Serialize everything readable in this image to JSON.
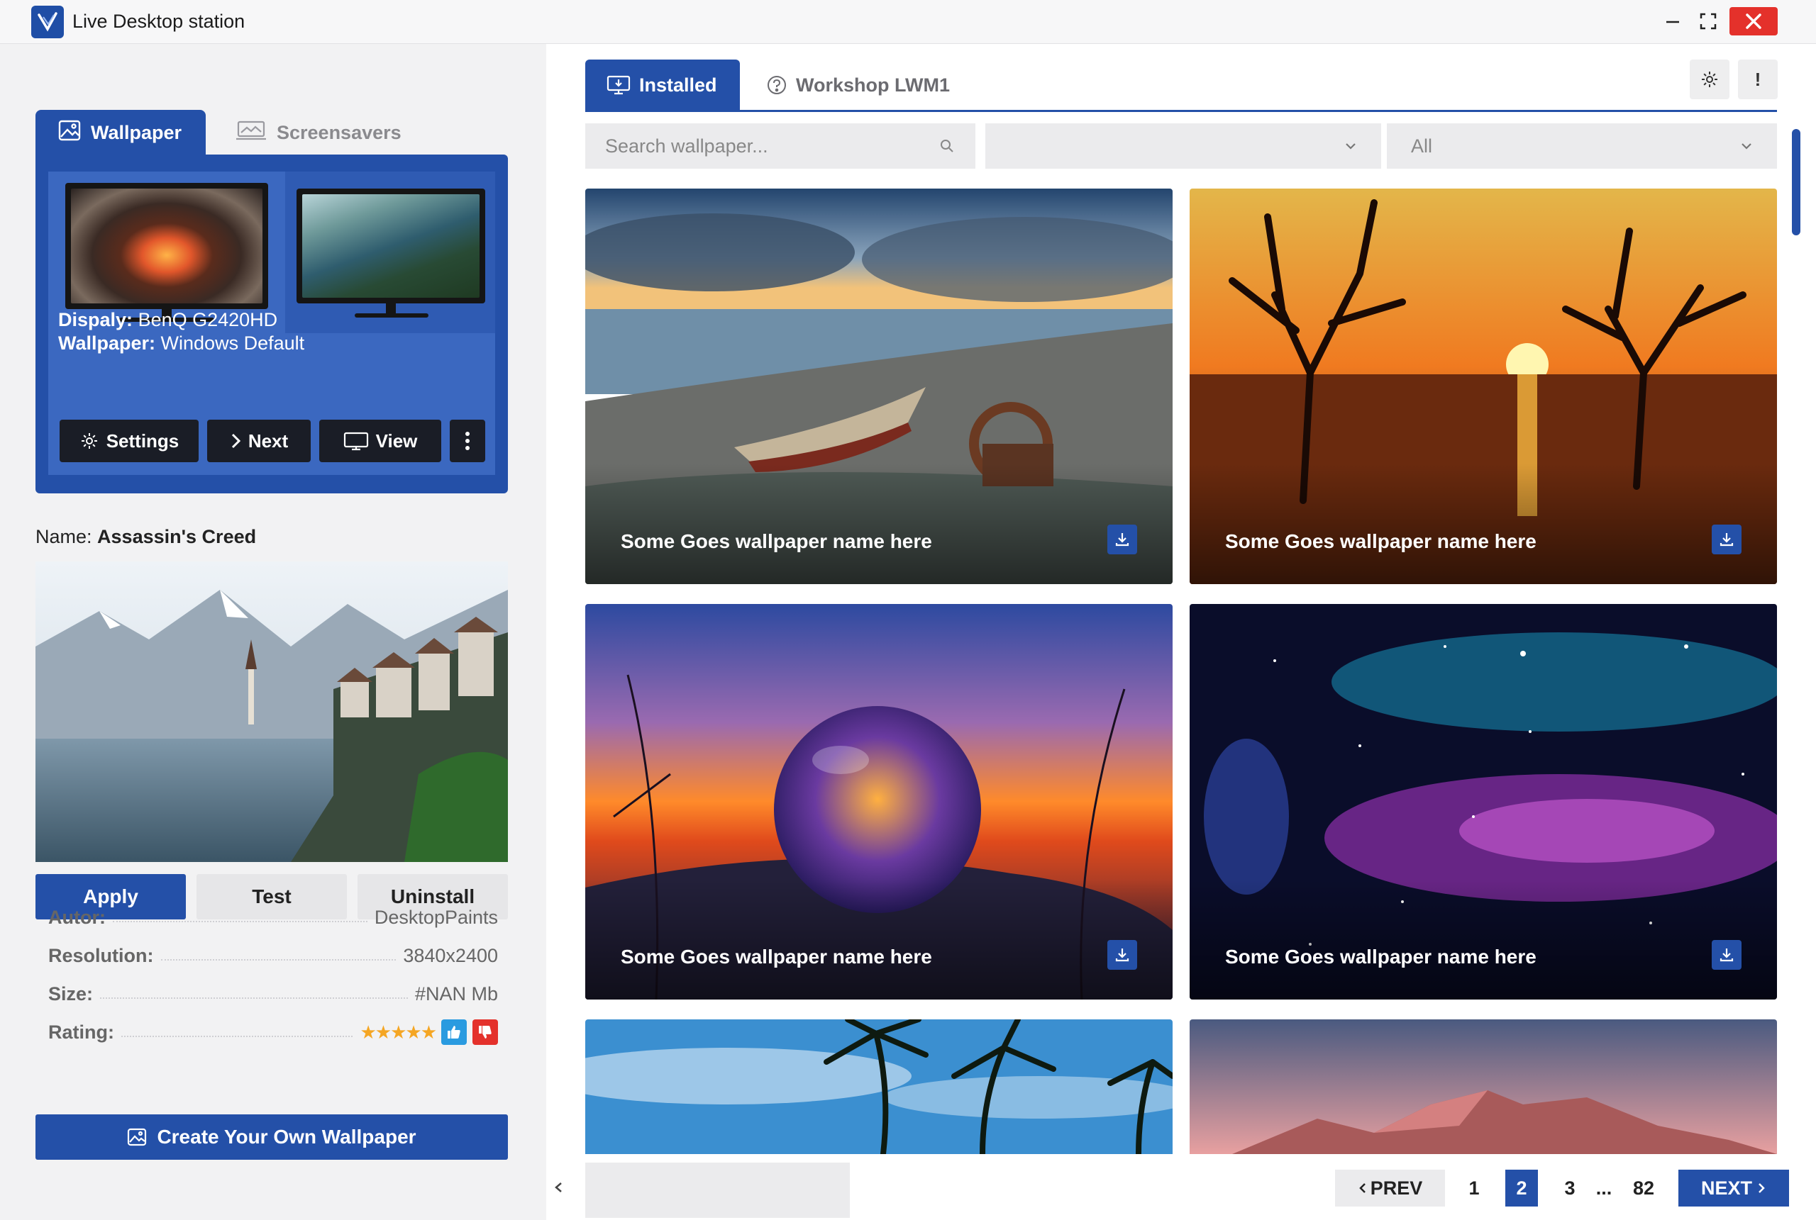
{
  "window": {
    "title": "Live Desktop station",
    "accent": "#2450a8",
    "close_color": "#e4312b"
  },
  "left_tabs": {
    "wallpaper": "Wallpaper",
    "screensavers": "Screensavers"
  },
  "display": {
    "display_key": "Dispaly:",
    "display_val": "BenQ G2420HD",
    "wallpaper_key": "Wallpaper:",
    "wallpaper_val": "Windows Default",
    "buttons": {
      "settings": "Settings",
      "next": "Next",
      "view": "View"
    }
  },
  "selected": {
    "name_key": "Name:",
    "name_val": "Assassin's Creed",
    "apply": "Apply",
    "test": "Test",
    "uninstall": "Uninstall",
    "details": [
      {
        "key": "Autor:",
        "val": "DesktopPaints"
      },
      {
        "key": "Resolution:",
        "val": "3840x2400"
      },
      {
        "key": "Size:",
        "val": "#NAN Mb"
      },
      {
        "key": "Rating:",
        "val": ""
      }
    ],
    "rating_stars": 5,
    "create": "Create Your Own Wallpaper"
  },
  "right_tabs": {
    "installed": "Installed",
    "workshop": "Workshop LWM1",
    "info_btn": "!"
  },
  "filters": {
    "search_placeholder": "Search wallpaper...",
    "dropdown1": "",
    "dropdown2": "All"
  },
  "cards": [
    {
      "title": "Some Goes wallpaper name here",
      "icon": "download-icon"
    },
    {
      "title": "Some Goes wallpaper name here",
      "icon": "download-icon"
    },
    {
      "title": "Some Goes wallpaper name here",
      "icon": "download-icon"
    },
    {
      "title": "Some Goes wallpaper name here",
      "icon": "download-icon"
    },
    {
      "title": "",
      "icon": ""
    },
    {
      "title": "",
      "icon": ""
    }
  ],
  "pagination": {
    "prev": "PREV",
    "pages": [
      "1",
      "2",
      "3",
      "...",
      "82"
    ],
    "current": "2",
    "next": "NEXT"
  }
}
